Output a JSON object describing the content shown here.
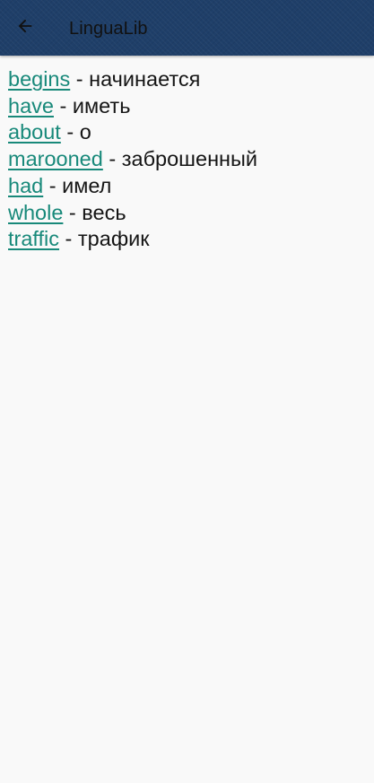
{
  "header": {
    "title": "LinguaLib",
    "back_icon": "arrow-left-icon"
  },
  "colors": {
    "app_bar": "#1f3f69",
    "link": "#18897a",
    "background": "#f9f9f9",
    "text": "#151515"
  },
  "words": [
    {
      "word": "begins",
      "separator": " - ",
      "translation": "начинается"
    },
    {
      "word": "have",
      "separator": " - ",
      "translation": "иметь"
    },
    {
      "word": "about",
      "separator": " - ",
      "translation": "о"
    },
    {
      "word": "marooned",
      "separator": " - ",
      "translation": "заброшенный"
    },
    {
      "word": "had",
      "separator": " - ",
      "translation": "имел"
    },
    {
      "word": "whole",
      "separator": " - ",
      "translation": "весь"
    },
    {
      "word": "traffic",
      "separator": " - ",
      "translation": "трафик"
    }
  ]
}
